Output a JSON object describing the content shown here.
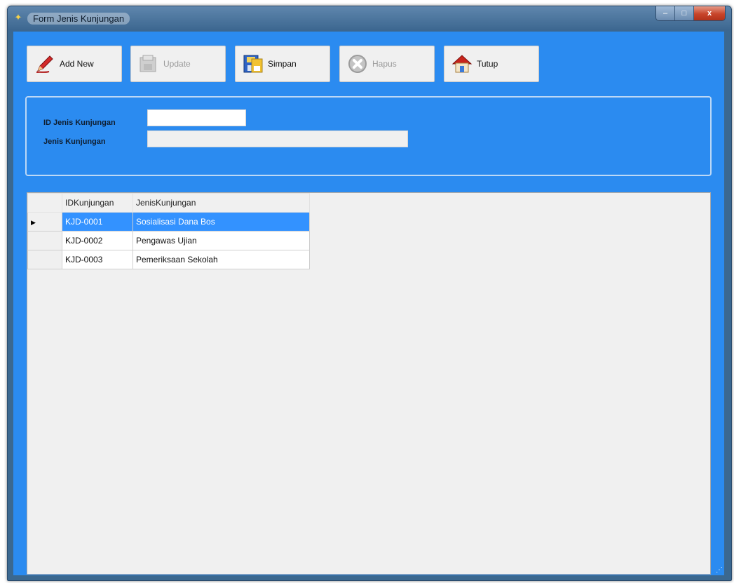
{
  "window": {
    "title": "Form Jenis Kunjungan",
    "controls": {
      "minimize": "–",
      "maximize": "□",
      "close": "x"
    }
  },
  "toolbar": {
    "add_new": {
      "label": "Add New",
      "icon": "pencil-icon",
      "enabled": true
    },
    "update": {
      "label": "Update",
      "icon": "update-icon",
      "enabled": false
    },
    "simpan": {
      "label": "Simpan",
      "icon": "save-icon",
      "enabled": true
    },
    "hapus": {
      "label": "Hapus",
      "icon": "delete-icon",
      "enabled": false
    },
    "tutup": {
      "label": "Tutup",
      "icon": "home-icon",
      "enabled": true
    }
  },
  "form": {
    "id_label": "ID Jenis Kunjungan",
    "id_value": "",
    "jenis_label": "Jenis Kunjungan",
    "jenis_value": ""
  },
  "grid": {
    "columns": [
      "IDKunjungan",
      "JenisKunjungan"
    ],
    "rows": [
      {
        "id": "KJD-0001",
        "jenis": "Sosialisasi Dana Bos",
        "selected": true
      },
      {
        "id": "KJD-0002",
        "jenis": "Pengawas Ujian",
        "selected": false
      },
      {
        "id": "KJD-0003",
        "jenis": "Pemeriksaan Sekolah",
        "selected": false
      }
    ],
    "current_row_marker": "▶"
  },
  "colors": {
    "client_background": "#2b8bf0",
    "selection": "#3392ff",
    "titlebar": "#3d6790"
  }
}
